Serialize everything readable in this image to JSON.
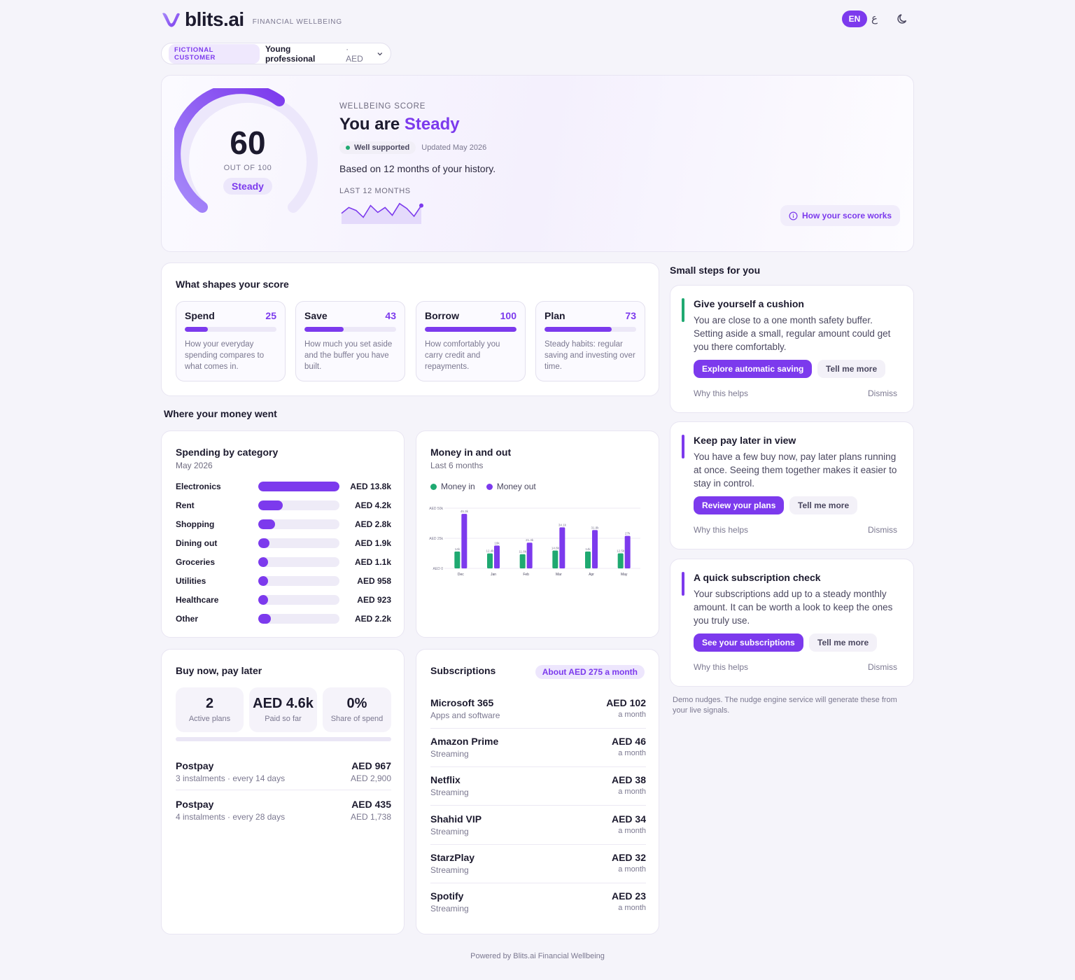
{
  "brand": {
    "name": "blits.ai",
    "subtitle": "FINANCIAL WELLBEING"
  },
  "header": {
    "lang_en": "EN",
    "lang_ar": "ع",
    "theme_icon": "moon-icon"
  },
  "persona": {
    "tag": "FICTIONAL CUSTOMER",
    "name": "Young professional",
    "currency": "· AED"
  },
  "score": {
    "value": "60",
    "value_num": 60,
    "out_of": "OUT OF 100",
    "band": "Steady",
    "label": "WELLBEING SCORE",
    "title_prefix": "You are",
    "title_band": "Steady",
    "support": "Well supported",
    "updated": "Updated May 2026",
    "basis": "Based on 12 months of your history.",
    "trend_label": "LAST 12 MONTHS",
    "trend": [
      52,
      58,
      55,
      48,
      60,
      53,
      58,
      50,
      62,
      57,
      49,
      60
    ],
    "how_button": "How your score works"
  },
  "factors": {
    "title": "What shapes your score",
    "items": [
      {
        "name": "Spend",
        "value": "25",
        "pct": 25,
        "desc": "How your everyday spending compares to what comes in."
      },
      {
        "name": "Save",
        "value": "43",
        "pct": 43,
        "desc": "How much you set aside and the buffer you have built."
      },
      {
        "name": "Borrow",
        "value": "100",
        "pct": 100,
        "desc": "How comfortably you carry credit and repayments."
      },
      {
        "name": "Plan",
        "value": "73",
        "pct": 73,
        "desc": "Steady habits: regular saving and investing over time."
      }
    ]
  },
  "money_section": {
    "title": "Where your money went"
  },
  "spending": {
    "title": "Spending by category",
    "period": "May 2026",
    "items": [
      {
        "name": "Electronics",
        "value": "AED 13.8k",
        "amount": 13800
      },
      {
        "name": "Rent",
        "value": "AED 4.2k",
        "amount": 4200
      },
      {
        "name": "Shopping",
        "value": "AED 2.8k",
        "amount": 2800
      },
      {
        "name": "Dining out",
        "value": "AED 1.9k",
        "amount": 1900
      },
      {
        "name": "Groceries",
        "value": "AED 1.1k",
        "amount": 1100
      },
      {
        "name": "Utilities",
        "value": "AED 958",
        "amount": 958
      },
      {
        "name": "Healthcare",
        "value": "AED 923",
        "amount": 923
      },
      {
        "name": "Other",
        "value": "AED 2.2k",
        "amount": 2200
      }
    ]
  },
  "chart_data": {
    "type": "bar",
    "title": "Money in and out",
    "subtitle": "Last 6 months",
    "categories": [
      "Dec",
      "Jan",
      "Feb",
      "Mar",
      "Apr",
      "May"
    ],
    "series": [
      {
        "name": "Money in",
        "values": [
          14000,
          12400,
          11800,
          14800,
          14000,
          12500
        ],
        "labels": [
          "14k",
          "12.4k",
          "11.8k",
          "14.8k",
          "14k",
          "12.5k"
        ],
        "color": "#1fa971"
      },
      {
        "name": "Money out",
        "values": [
          45300,
          19000,
          21400,
          34100,
          31800,
          27000
        ],
        "labels": [
          "45.3k",
          "19k",
          "21.4k",
          "34.1k",
          "31.8k",
          "27k"
        ],
        "color": "#7c3aed"
      }
    ],
    "yticks": [
      "AED 0",
      "AED 25k",
      "AED 50k"
    ],
    "ylim": [
      0,
      50000
    ],
    "legend": "top-left",
    "grid": true
  },
  "bnpl": {
    "title": "Buy now, pay later",
    "stats": [
      {
        "value": "2",
        "label": "Active plans"
      },
      {
        "value": "AED 4.6k",
        "label": "Paid so far"
      },
      {
        "value": "0%",
        "label": "Share of spend"
      }
    ],
    "progress": 0,
    "plans": [
      {
        "name": "Postpay",
        "detail": "3 instalments · every 14 days",
        "amount": "AED 967",
        "total": "AED 2,900"
      },
      {
        "name": "Postpay",
        "detail": "4 instalments · every 28 days",
        "amount": "AED 435",
        "total": "AED 1,738"
      }
    ]
  },
  "subscriptions": {
    "title": "Subscriptions",
    "badge": "About AED 275 a month",
    "items": [
      {
        "name": "Microsoft 365",
        "category": "Apps and software",
        "amount": "AED 102",
        "period": "a month"
      },
      {
        "name": "Amazon Prime",
        "category": "Streaming",
        "amount": "AED 46",
        "period": "a month"
      },
      {
        "name": "Netflix",
        "category": "Streaming",
        "amount": "AED 38",
        "period": "a month"
      },
      {
        "name": "Shahid VIP",
        "category": "Streaming",
        "amount": "AED 34",
        "period": "a month"
      },
      {
        "name": "StarzPlay",
        "category": "Streaming",
        "amount": "AED 32",
        "period": "a month"
      },
      {
        "name": "Spotify",
        "category": "Streaming",
        "amount": "AED 23",
        "period": "a month"
      }
    ]
  },
  "steps": {
    "title": "Small steps for you",
    "items": [
      {
        "title": "Give yourself a cushion",
        "desc": "You are close to a one month safety buffer. Setting aside a small, regular amount could get you there comfortably.",
        "primary": "Explore automatic saving",
        "secondary": "Tell me more",
        "why": "Why this helps",
        "dismiss": "Dismiss",
        "accent": "#1fa971"
      },
      {
        "title": "Keep pay later in view",
        "desc": "You have a few buy now, pay later plans running at once. Seeing them together makes it easier to stay in control.",
        "primary": "Review your plans",
        "secondary": "Tell me more",
        "why": "Why this helps",
        "dismiss": "Dismiss",
        "accent": "#7c3aed"
      },
      {
        "title": "A quick subscription check",
        "desc": "Your subscriptions add up to a steady monthly amount. It can be worth a look to keep the ones you truly use.",
        "primary": "See your subscriptions",
        "secondary": "Tell me more",
        "why": "Why this helps",
        "dismiss": "Dismiss",
        "accent": "#7c3aed"
      }
    ],
    "note": "Demo nudges. The nudge engine service will generate these from your live signals."
  },
  "footer": {
    "text": "Powered by Blits.ai Financial Wellbeing"
  }
}
